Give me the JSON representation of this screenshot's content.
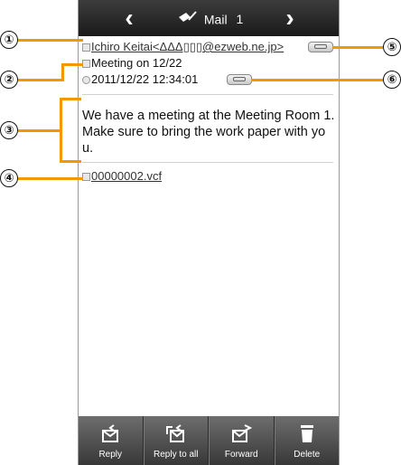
{
  "titlebar": {
    "title": "Mail",
    "count": "1",
    "prev_icon": "chevron-left-icon",
    "next_icon": "chevron-right-icon"
  },
  "header": {
    "from_text": "Ichiro Keitai<ΔΔΔ▯▯▯@ezweb.ne.jp>",
    "subject": "Meeting on 12/22",
    "date": "2011/12/22 12:34:01"
  },
  "body": {
    "line1": "We have a meeting at the Meeting Room 1.",
    "line2": "Make sure to bring the work paper with yo",
    "line3": "u."
  },
  "attachment": {
    "filename": "00000002.vcf"
  },
  "toolbar": {
    "reply": "Reply",
    "reply_all": "Reply to all",
    "forward": "Forward",
    "delete": "Delete"
  },
  "callouts": [
    "①",
    "②",
    "③",
    "④",
    "⑤",
    "⑥"
  ],
  "colors": {
    "accent": "#f39800",
    "titlebar": "#2a2a2a",
    "toolbar": "#555555"
  }
}
